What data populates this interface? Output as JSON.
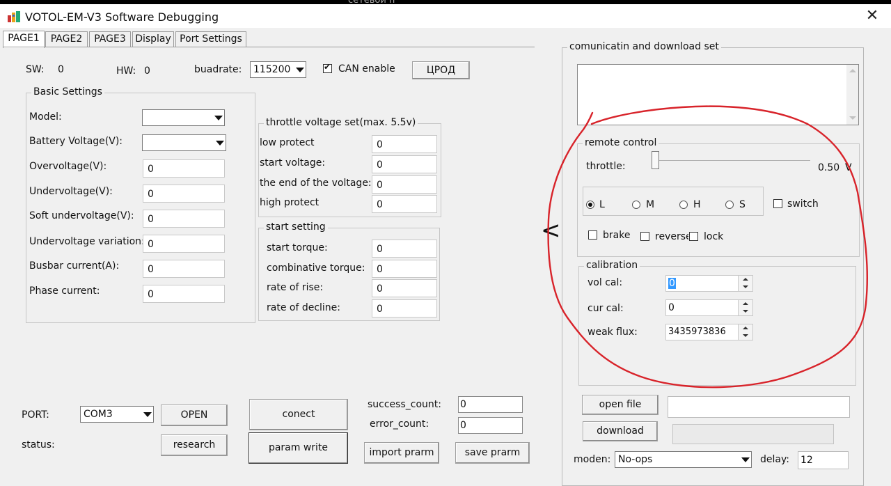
{
  "top_cropped_text": "сетевой п",
  "window": {
    "title": "VOTOL-EM-V3 Software Debugging",
    "close_glyph": "✕"
  },
  "tabs": [
    "PAGE1",
    "PAGE2",
    "PAGE3",
    "Display",
    "Port Settings"
  ],
  "header": {
    "sw_label": "SW:",
    "sw_value": "0",
    "hw_label": "HW:",
    "hw_value": "0",
    "baud_label": "buadrate:",
    "baud_value": "115200",
    "can_label": "CAN enable",
    "upod_button": "ЦРОД"
  },
  "basic": {
    "title": "Basic Settings",
    "rows": [
      {
        "label": "Model:",
        "type": "combo",
        "value": ""
      },
      {
        "label": "Battery Voltage(V):",
        "type": "combo",
        "value": ""
      },
      {
        "label": "Overvoltage(V):",
        "type": "text",
        "value": "0"
      },
      {
        "label": "Undervoltage(V):",
        "type": "text",
        "value": "0"
      },
      {
        "label": "Soft undervoltage(V):",
        "type": "text",
        "value": "0"
      },
      {
        "label": "Undervoltage variation:",
        "type": "text",
        "value": "0"
      },
      {
        "label": "Busbar current(A):",
        "type": "text",
        "value": "0"
      },
      {
        "label": "Phase current:",
        "type": "text",
        "value": "0"
      }
    ]
  },
  "throttle": {
    "title": "throttle voltage set(max. 5.5v)",
    "rows": [
      {
        "label": "low protect",
        "value": "0"
      },
      {
        "label": "start voltage:",
        "value": "0"
      },
      {
        "label": "the end of the voltage:",
        "value": "0"
      },
      {
        "label": "high protect",
        "value": "0"
      }
    ]
  },
  "start": {
    "title": "start setting",
    "rows": [
      {
        "label": "start torque:",
        "value": "0"
      },
      {
        "label": "combinative torque:",
        "value": "0"
      },
      {
        "label": "rate of rise:",
        "value": "0"
      },
      {
        "label": "rate of decline:",
        "value": "0"
      }
    ]
  },
  "bottom": {
    "port_label": "PORT:",
    "port_value": "COM3",
    "open_button": "OPEN",
    "status_label": "status:",
    "research_button": "research",
    "connect_button": "conect",
    "param_write_button": "param write",
    "success_label": "success_count:",
    "success_value": "0",
    "error_label": "error_count:",
    "error_value": "0",
    "import_button": "import prarm",
    "save_button": "save prarm"
  },
  "arrow_glyph": "<",
  "right": {
    "title": "comunicatin and download set",
    "remote": {
      "title": "remote control",
      "throttle_label": "throttle:",
      "throttle_level": 0,
      "throttle_value": "0.50",
      "throttle_unit": "V",
      "gears": [
        "L",
        "M",
        "H",
        "S"
      ],
      "gear_selected": "L",
      "switch_label": "switch",
      "brake_label": "brake",
      "reverse_label": "reverse",
      "lock_label": "lock"
    },
    "calibration": {
      "title": "calibration",
      "rows": [
        {
          "label": "vol cal:",
          "value": "0"
        },
        {
          "label": "cur cal:",
          "value": "0"
        },
        {
          "label": "weak flux:",
          "value": "3435973836"
        }
      ]
    },
    "open_file_button": "open file",
    "download_button": "download",
    "moden_label": "moden:",
    "moden_value": "No-ops",
    "delay_label": "delay:",
    "delay_value": "12"
  },
  "colors": {
    "annotation_red": "#d8232a",
    "selection_blue": "#3399ff"
  }
}
